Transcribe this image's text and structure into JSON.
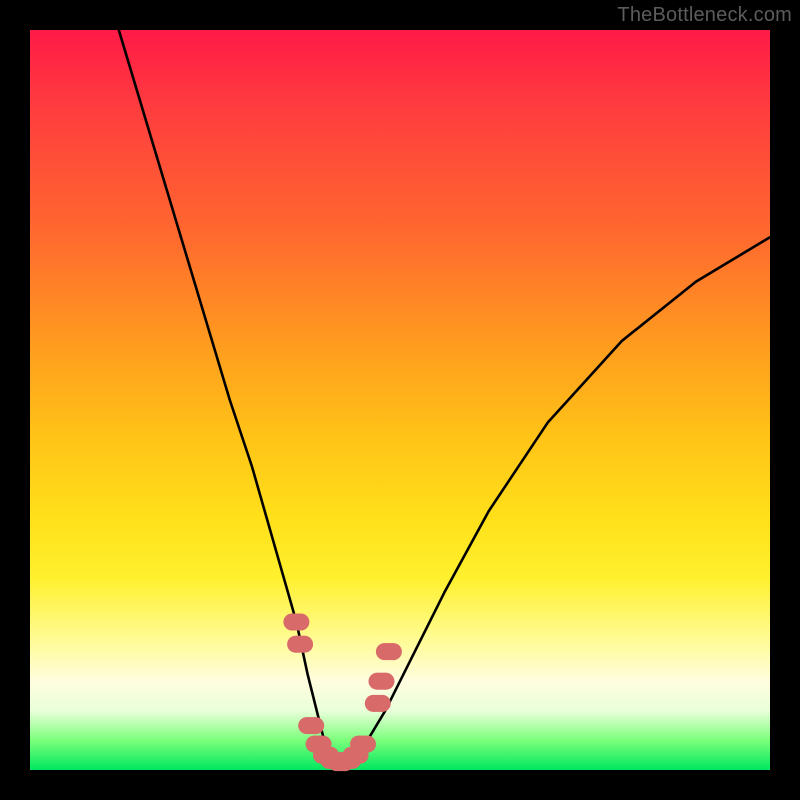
{
  "watermark": {
    "text": "TheBottleneck.com"
  },
  "colors": {
    "curve_stroke": "#000000",
    "marker_fill": "#d86a6a",
    "marker_stroke": "#c75858",
    "background_black": "#000000"
  },
  "chart_data": {
    "type": "line",
    "title": "",
    "xlabel": "",
    "ylabel": "",
    "xlim": [
      0,
      100
    ],
    "ylim": [
      0,
      100
    ],
    "grid": false,
    "legend": false,
    "series": [
      {
        "name": "bottleneck-curve",
        "x": [
          12,
          15,
          18,
          21,
          24,
          27,
          30,
          32,
          34,
          36,
          37.5,
          39,
          40,
          41,
          42,
          43,
          45,
          48,
          52,
          56,
          62,
          70,
          80,
          90,
          100
        ],
        "y": [
          100,
          90,
          80,
          70,
          60,
          50,
          41,
          34,
          27,
          20,
          13,
          7,
          3,
          1,
          0.5,
          1,
          3,
          8,
          16,
          24,
          35,
          47,
          58,
          66,
          72
        ]
      }
    ],
    "markers": [
      {
        "x": 36.0,
        "y": 20
      },
      {
        "x": 36.5,
        "y": 17
      },
      {
        "x": 38.0,
        "y": 6
      },
      {
        "x": 39.0,
        "y": 3.5
      },
      {
        "x": 40.0,
        "y": 2
      },
      {
        "x": 41.0,
        "y": 1.3
      },
      {
        "x": 42.0,
        "y": 1
      },
      {
        "x": 43.0,
        "y": 1.3
      },
      {
        "x": 44.0,
        "y": 2
      },
      {
        "x": 45.0,
        "y": 3.5
      },
      {
        "x": 47.0,
        "y": 9
      },
      {
        "x": 47.5,
        "y": 12
      },
      {
        "x": 48.5,
        "y": 16
      }
    ]
  }
}
